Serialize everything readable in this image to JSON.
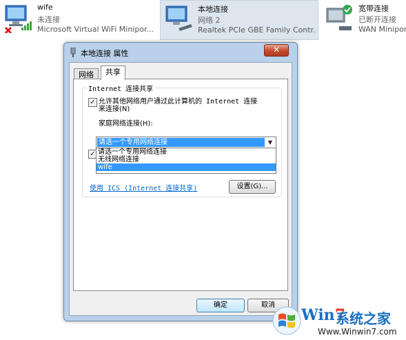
{
  "connections": [
    {
      "name": "wife",
      "status": "未连接",
      "device": "Microsoft Virtual WiFi Minipor..."
    },
    {
      "name": "本地连接",
      "status": "网络 2",
      "device": "Realtek PCIe GBE Family Contr..."
    },
    {
      "name": "宽带连接",
      "status": "已断开连接",
      "device": "WAN Minipor"
    }
  ],
  "dialog": {
    "title": "本地连接 属性",
    "close_label": "✕",
    "tabs": [
      "网络",
      "共享"
    ],
    "group_title": "Internet 连接共享",
    "allow_share_line1": "允许其他网络用户通过此计算机的 Internet 连接",
    "allow_share_line2": "来连接(N)",
    "home_network_label": "家庭网络连接(H):",
    "combo_value": "请选一个专用网络连接",
    "combo_options": [
      "请选一个专用网络连接",
      "无线网络连接",
      "wife"
    ],
    "ics_link": "使用 ICS (Internet 连接共享)",
    "settings_button": "设置(G)...",
    "ok_button": "确定",
    "cancel_button": "取消"
  },
  "watermark": {
    "brand_win": "Win",
    "brand_seven": "7",
    "brand_cn": "系统之家",
    "url": "Www.Winwin7.com"
  },
  "colors": {
    "selection": "#3399ff",
    "link": "#0066cc",
    "close_button": "#c44a2e",
    "dialog_frame": "#b9d1ea",
    "selected_item": "#dde6ef"
  }
}
